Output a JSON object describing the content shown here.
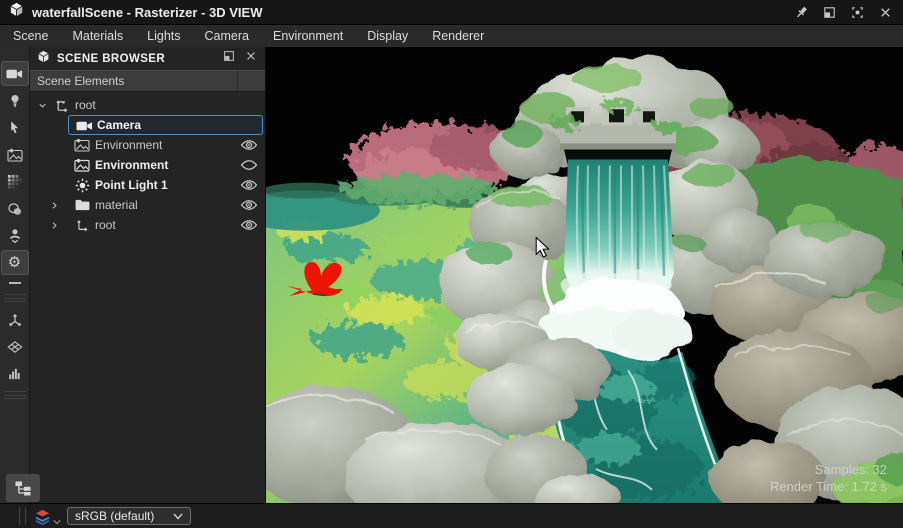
{
  "window": {
    "title": "waterfallScene - Rasterizer - 3D VIEW",
    "controls": [
      "pin",
      "restore",
      "maximize",
      "close"
    ]
  },
  "menu": {
    "items": [
      "Scene",
      "Materials",
      "Lights",
      "Camera",
      "Environment",
      "Display",
      "Renderer"
    ]
  },
  "toolbar": {
    "items": [
      "camera",
      "light-bulb",
      "select-pointer",
      "environment-image",
      "texture-dither",
      "render-spheres",
      "turntable-figure",
      "settings-gear",
      "collapse-minus",
      "transform-axes",
      "ground-plane",
      "histogram"
    ],
    "active_item": "camera"
  },
  "scene_browser": {
    "title": "SCENE BROWSER",
    "columns": {
      "elements": "Scene Elements"
    },
    "tree": [
      {
        "label": "root",
        "icon": "transform-axes",
        "level": 0,
        "state": "expanded",
        "visibility": null,
        "selected": false,
        "bold": false
      },
      {
        "label": "Camera",
        "icon": "camera",
        "level": 1,
        "state": null,
        "visibility": null,
        "selected": true,
        "bold": true
      },
      {
        "label": "Environment",
        "icon": "environment",
        "level": 1,
        "state": null,
        "visibility": "visible",
        "selected": false,
        "bold": false
      },
      {
        "label": "Environment",
        "icon": "environment",
        "level": 1,
        "state": null,
        "visibility": "hidden",
        "selected": false,
        "bold": true
      },
      {
        "label": "Point Light 1",
        "icon": "point-light",
        "level": 1,
        "state": null,
        "visibility": "visible",
        "selected": false,
        "bold": true
      },
      {
        "label": "material",
        "icon": "folder",
        "level": 1,
        "state": "collapsed",
        "visibility": "visible",
        "selected": false,
        "bold": false
      },
      {
        "label": "root",
        "icon": "transform-axes",
        "level": 1,
        "state": "collapsed",
        "visibility": "visible",
        "selected": false,
        "bold": false
      }
    ]
  },
  "viewport": {
    "stats": {
      "samples": "Samples: 32",
      "render_time": "Render Time: 1.72 s"
    },
    "scene_objects": [
      "rock-cliffs",
      "stone-bridge-ruin",
      "waterfall",
      "foam-pool",
      "river",
      "moss-ground",
      "pink-foliage",
      "maroon-foliage",
      "red-bird"
    ]
  },
  "status_bar": {
    "color_profile": "sRGB (default)"
  },
  "colors": {
    "selection_accent": "#4a8fd0",
    "viewport_bg": "#000000",
    "water_teal": "#2f9a8a",
    "foam_white": "#ffffff",
    "foliage_pink": "#b96c7c",
    "foliage_maroon": "#7e3f4a",
    "moss_green": "#a8d45e",
    "bird_red": "#ea1506",
    "titlebar_bg": "#161616",
    "menubar_bg": "#2a2a2a",
    "panel_bg": "#242424"
  }
}
